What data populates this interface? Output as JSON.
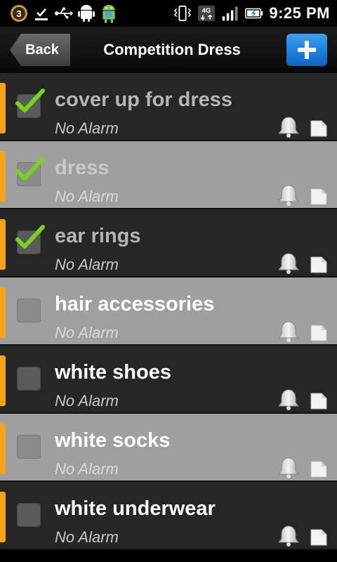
{
  "status_bar": {
    "notification_count": "3",
    "network": "4G",
    "time": "9:25 PM"
  },
  "header": {
    "back_label": "Back",
    "title": "Competition Dress",
    "add_label": "+"
  },
  "items": [
    {
      "name": "cover up for dress",
      "alarm": "No Alarm",
      "checked": true
    },
    {
      "name": "dress",
      "alarm": "No Alarm",
      "checked": true
    },
    {
      "name": "ear rings",
      "alarm": "No Alarm",
      "checked": true
    },
    {
      "name": "hair accessories",
      "alarm": "No Alarm",
      "checked": false
    },
    {
      "name": "white shoes",
      "alarm": "No Alarm",
      "checked": false
    },
    {
      "name": "white socks",
      "alarm": "No Alarm",
      "checked": false
    },
    {
      "name": "white underwear",
      "alarm": "No Alarm",
      "checked": false
    }
  ],
  "colors": {
    "accent_stripe": "#f6a21d",
    "check_green": "#7bd11e",
    "add_button": "#1b7fe0",
    "row_dark": "#262626",
    "row_light": "#9f9f9f"
  },
  "icons": {
    "row_alarm": "bell-icon",
    "row_note": "note-icon",
    "row_check": "checkmark-icon"
  }
}
